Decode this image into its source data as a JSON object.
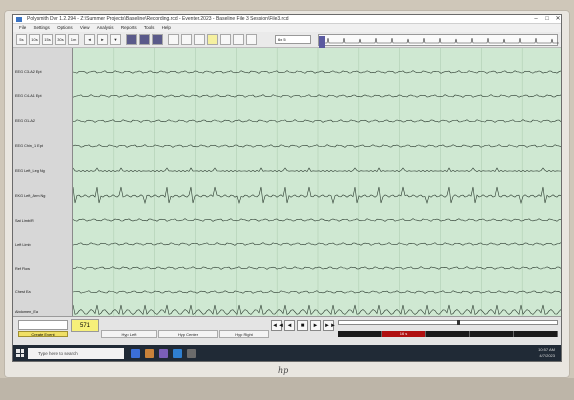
{
  "window": {
    "title": "Polysmith Dvr 1.2.294 - Z:\\Summer Projects\\Baseline\\Recording.rcd - Eventer.2023 - Baseline File 3 Session\\File3.rcd",
    "controls": [
      "–",
      "□",
      "✕"
    ]
  },
  "menu": {
    "items": [
      "File",
      "Settings",
      "Options",
      "View",
      "Analysis",
      "Reports",
      "Tools",
      "Help"
    ]
  },
  "toolbar": {
    "buttons": [
      "5s",
      "10s",
      "15s",
      "30s",
      "1m",
      "◄",
      "►",
      "▼"
    ],
    "speed_value": "6x 5"
  },
  "channels": [
    {
      "label": "EEG C3-A2 Ept"
    },
    {
      "label": "EEG C4-A1 Ept"
    },
    {
      "label": "EEG O1-A2"
    },
    {
      "label": "EEG Chin_1 Ept"
    },
    {
      "label": "EEG Left_Leg Ng"
    },
    {
      "label": "EKG Left_Arm Ng"
    },
    {
      "label": "Sat Limb/R"
    },
    {
      "label": "Left Limb"
    },
    {
      "label": "Ref Flow"
    },
    {
      "label": "Chest Ea"
    },
    {
      "label": "Abdomen_Ea"
    }
  ],
  "bottom": {
    "counter": "571",
    "event_button": "Create Event",
    "tabs": [
      "Hyp Left",
      "Hyp Center",
      "Hyp Right"
    ],
    "nav": [
      "◄◄",
      "◄",
      "■",
      "►",
      "►►"
    ],
    "segment_label": "16 s"
  },
  "taskbar": {
    "search_placeholder": "Type here to search",
    "time": "10:57 AM",
    "date": "4/7/2023"
  },
  "monitor": {
    "logo": "hp"
  },
  "colors": {
    "plot_bg": "#cfe8d2",
    "trace": "#2b3a2f",
    "accent_yellow": "#f6f07a",
    "segment_red": "#b01010"
  }
}
